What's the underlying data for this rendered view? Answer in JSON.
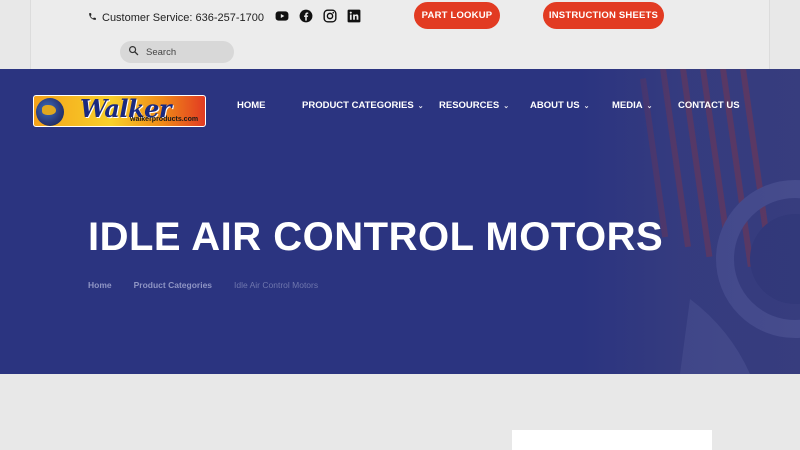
{
  "topbar": {
    "phone_text": "Customer Service: 636-257-1700",
    "social_icons": [
      "youtube-icon",
      "facebook-icon",
      "instagram-icon",
      "linkedin-icon"
    ],
    "part_lookup_label": "PART LOOKUP",
    "instruction_sheets_label": "INSTRUCTION SHEETS",
    "search_placeholder": "Search"
  },
  "logo": {
    "wordmark": "Walker",
    "url_text": "walkerproducts.com"
  },
  "nav": {
    "items": [
      {
        "label": "HOME",
        "has_dropdown": false
      },
      {
        "label": "PRODUCT CATEGORIES",
        "has_dropdown": true
      },
      {
        "label": "RESOURCES",
        "has_dropdown": true
      },
      {
        "label": "ABOUT US",
        "has_dropdown": true
      },
      {
        "label": "MEDIA",
        "has_dropdown": true
      },
      {
        "label": "CONTACT US",
        "has_dropdown": false
      }
    ]
  },
  "hero": {
    "title": "IDLE AIR CONTROL MOTORS",
    "breadcrumb": [
      "Home",
      "Product Categories",
      "Idle Air Control Motors"
    ]
  },
  "colors": {
    "accent": "#e23b22",
    "hero_bg": "#2b3480",
    "topbar_bg": "#ececec"
  }
}
